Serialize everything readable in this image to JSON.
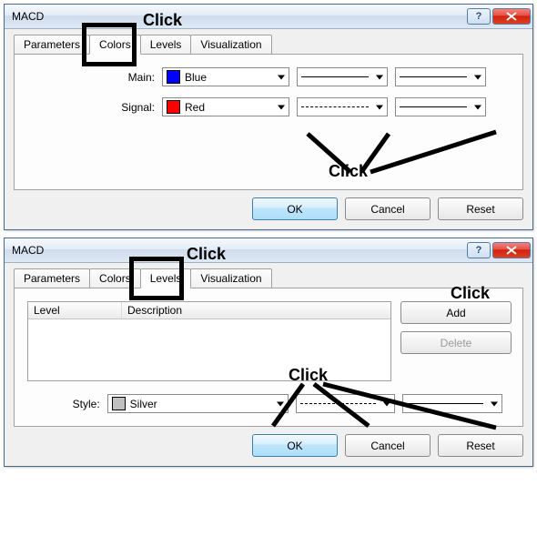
{
  "dialog1": {
    "title": "MACD",
    "tabs": [
      "Parameters",
      "Colors",
      "Levels",
      "Visualization"
    ],
    "active_tab": "Colors",
    "rows": {
      "main": {
        "label": "Main:",
        "color_name": "Blue",
        "color_hex": "#0000FF"
      },
      "signal": {
        "label": "Signal:",
        "color_name": "Red",
        "color_hex": "#FF0000"
      }
    },
    "buttons": {
      "ok": "OK",
      "cancel": "Cancel",
      "reset": "Reset"
    }
  },
  "dialog2": {
    "title": "MACD",
    "tabs": [
      "Parameters",
      "Colors",
      "Levels",
      "Visualization"
    ],
    "active_tab": "Levels",
    "columns": {
      "level": "Level",
      "description": "Description"
    },
    "side": {
      "add": "Add",
      "delete": "Delete"
    },
    "style": {
      "label": "Style:",
      "color_name": "Silver",
      "color_hex": "#C0C0C0"
    },
    "buttons": {
      "ok": "OK",
      "cancel": "Cancel",
      "reset": "Reset"
    }
  },
  "annotations": {
    "click": "Click"
  }
}
